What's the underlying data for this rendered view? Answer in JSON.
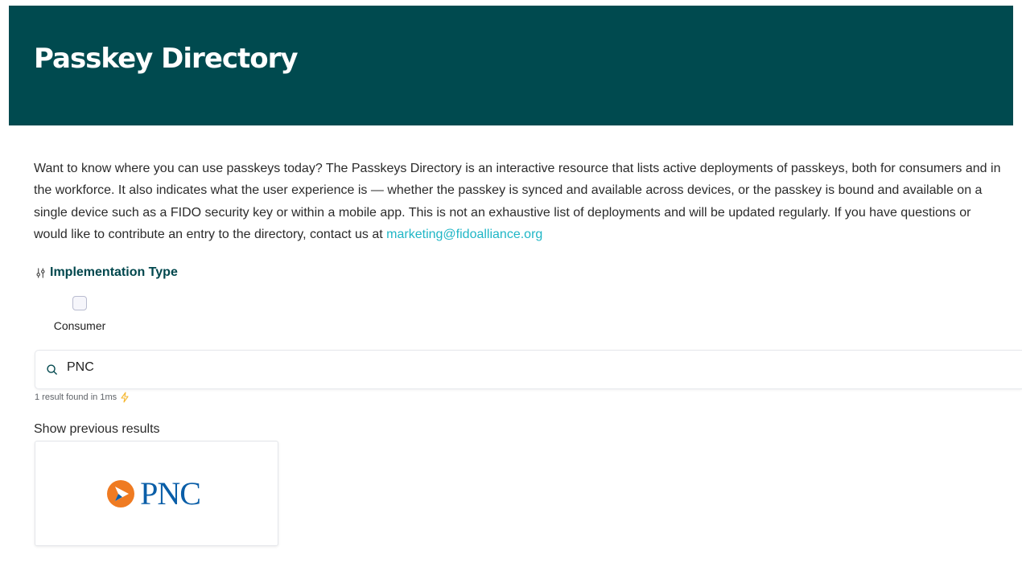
{
  "header": {
    "title": "Passkey Directory"
  },
  "intro": {
    "text": "Want to know where you can use passkeys today? The Passkeys Directory is an interactive resource that lists active deployments of passkeys, both for consumers and in the workforce. It also indicates what the user experience is — whether the passkey is synced and available across devices, or the passkey is bound and available on a single device such as a FIDO security key or within a mobile app. This is not an exhaustive list of deployments and will be updated regularly. If you have questions or would like to contribute an entry to the directory, contact us at",
    "contact_email": "marketing@fidoalliance.org"
  },
  "filters": {
    "title": "Implementation Type",
    "options": [
      {
        "label": "Consumer",
        "checked": false
      }
    ]
  },
  "search": {
    "value": "PNC",
    "icon": "search-icon"
  },
  "stats": {
    "text": "1 result found in 1ms",
    "icon": "lightning-icon"
  },
  "results": {
    "show_previous_label": "Show previous results",
    "items": [
      {
        "logo_text": "PNC",
        "logo_icon": "pnc-logo-icon"
      }
    ]
  },
  "colors": {
    "header_bg": "#004a4f",
    "accent_link": "#1fb6c6",
    "filter_title": "#00474d",
    "pnc_blue": "#0a5ea8",
    "pnc_orange": "#ef7b22"
  }
}
